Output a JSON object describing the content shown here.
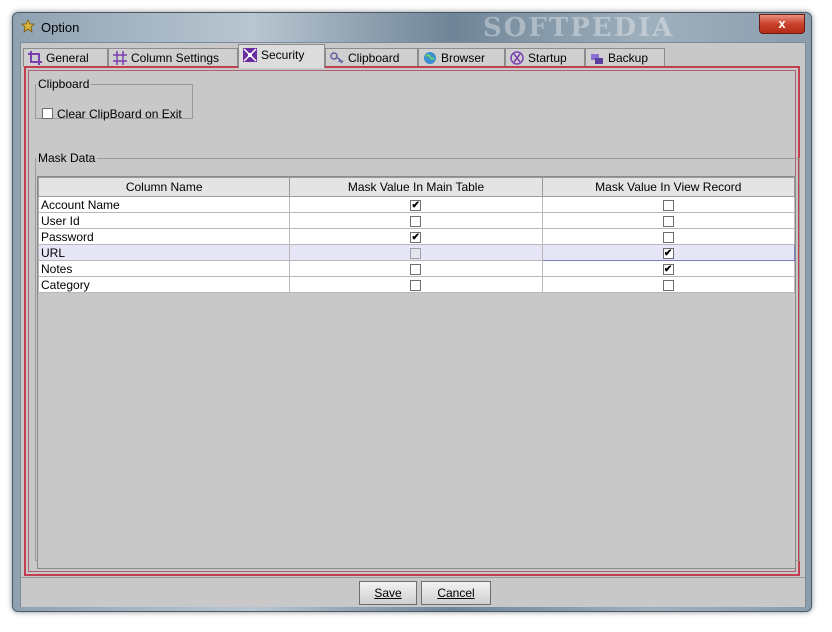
{
  "window": {
    "title": "Option",
    "watermark": "SOFTPEDIA",
    "close_label": "x"
  },
  "tabs": [
    {
      "label": "General",
      "icon": "crop-icon",
      "active": false
    },
    {
      "label": "Column Settings",
      "icon": "grid-icon",
      "active": false
    },
    {
      "label": "Security",
      "icon": "shield-grid-icon",
      "active": true
    },
    {
      "label": "Clipboard",
      "icon": "clipboard-key-icon",
      "active": false
    },
    {
      "label": "Browser",
      "icon": "globe-icon",
      "active": false
    },
    {
      "label": "Startup",
      "icon": "startup-icon",
      "active": false
    },
    {
      "label": "Backup",
      "icon": "backup-icon",
      "active": false
    }
  ],
  "clipboard": {
    "legend": "Clipboard",
    "clear_on_exit_label": "Clear ClipBoard on Exit",
    "clear_on_exit_checked": false
  },
  "mask": {
    "legend": "Mask Data",
    "columns": [
      "Column Name",
      "Mask Value In Main Table",
      "Mask Value In View Record"
    ],
    "rows": [
      {
        "name": "Account Name",
        "main": true,
        "view": false
      },
      {
        "name": "User Id",
        "main": false,
        "view": false
      },
      {
        "name": "Password",
        "main": true,
        "view": false
      },
      {
        "name": "URL",
        "main": false,
        "view": true,
        "selected": true
      },
      {
        "name": "Notes",
        "main": false,
        "view": true
      },
      {
        "name": "Category",
        "main": false,
        "view": false
      }
    ]
  },
  "buttons": {
    "save": "Save",
    "cancel": "Cancel"
  },
  "colors": {
    "panel_border": "#c0404f",
    "selection": "#e6e6f7"
  }
}
